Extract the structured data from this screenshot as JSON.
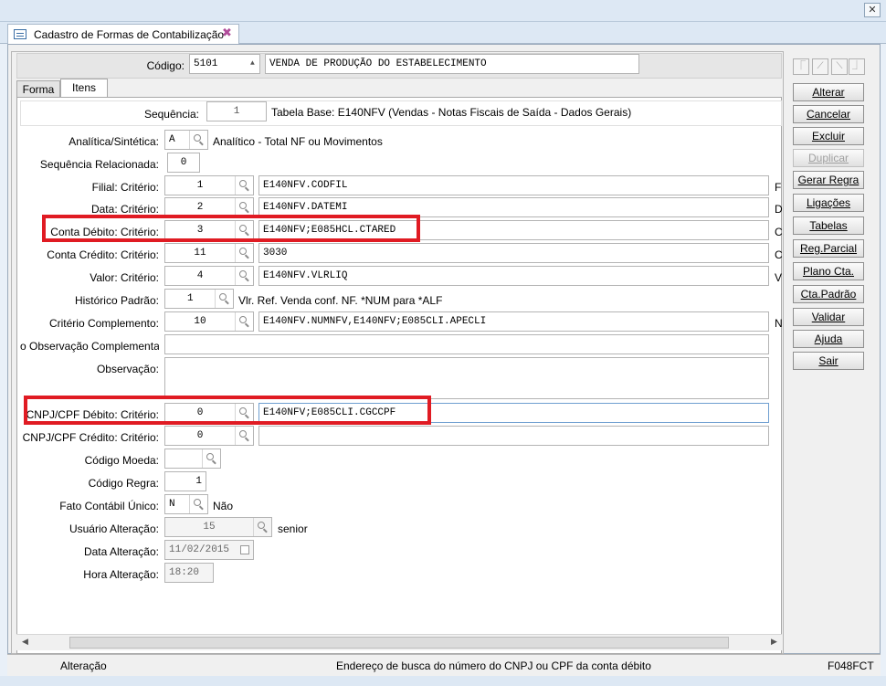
{
  "window": {
    "close_glyph": "✕"
  },
  "doc_tab": {
    "title": "Cadastro de Formas de Contabilização",
    "close_glyph": "✖"
  },
  "header": {
    "codigo_label": "Código:",
    "codigo_value": "5101",
    "descricao_value": "VENDA DE PRODUÇÃO DO ESTABELECIMENTO"
  },
  "subtabs": {
    "forma": "Forma",
    "itens": "Itens"
  },
  "sequencia": {
    "label": "Sequência:",
    "value": "1",
    "tabela_base": "Tabela Base: E140NFV (Vendas - Notas Fiscais de Saída - Dados Gerais)"
  },
  "form": {
    "analitica": {
      "label": "Analítica/Sintética:",
      "value": "A",
      "desc": "Analítico - Total NF ou Movimentos"
    },
    "seq_relacionada": {
      "label": "Sequência Relacionada:",
      "value": "0"
    },
    "filial": {
      "label": "Filial: Critério:",
      "num": "1",
      "expr": "E140NFV.CODFIL",
      "side": "F"
    },
    "data": {
      "label": "Data: Critério:",
      "num": "2",
      "expr": "E140NFV.DATEMI",
      "side": "D"
    },
    "conta_debito": {
      "label": "Conta Débito: Critério:",
      "num": "3",
      "expr": "E140NFV;E085HCL.CTARED",
      "side": "C"
    },
    "conta_credito": {
      "label": "Conta Crédito: Critério:",
      "num": "11",
      "expr": "3030",
      "side": "C"
    },
    "valor": {
      "label": "Valor: Critério:",
      "num": "4",
      "expr": "E140NFV.VLRLIQ",
      "side": "V"
    },
    "historico": {
      "label": "Histórico Padrão:",
      "num": "1",
      "desc": "Vlr. Ref. Venda conf. NF. *NUM para *ALF"
    },
    "complemento": {
      "label": "Critério Complemento:",
      "num": "10",
      "expr": "E140NFV.NUMNFV,E140NFV;E085CLI.APECLI",
      "side": "N"
    },
    "obs_complementar": {
      "label": "o Observação Complementar:",
      "value": ""
    },
    "observacao": {
      "label": "Observação:",
      "value": ""
    },
    "cnpj_debito": {
      "label": "CNPJ/CPF Débito: Critério:",
      "num": "0",
      "expr": "E140NFV;E085CLI.CGCCPF"
    },
    "cnpj_credito": {
      "label": "CNPJ/CPF Crédito: Critério:",
      "num": "0",
      "expr": ""
    },
    "codigo_moeda": {
      "label": "Código Moeda:",
      "value": ""
    },
    "codigo_regra": {
      "label": "Código Regra:",
      "value": "1"
    },
    "fato_contabil": {
      "label": "Fato Contábil Único:",
      "value": "N",
      "desc": "Não"
    },
    "usuario": {
      "label": "Usuário Alteração:",
      "value": "15",
      "desc": "senior"
    },
    "data_alteracao": {
      "label": "Data Alteração:",
      "value": "11/02/2015"
    },
    "hora_alteracao": {
      "label": "Hora Alteração:",
      "value": "18:20"
    }
  },
  "buttons": {
    "alterar": "Alterar",
    "cancelar": "Cancelar",
    "excluir": "Excluir",
    "duplicar": "Duplicar",
    "gerar_regra": "Gerar Regra",
    "ligacoes": "Ligações",
    "tabelas": "Tabelas",
    "reg_parcial": "Reg.Parcial",
    "plano_cta": "Plano Cta.",
    "cta_padrao": "Cta.Padrão",
    "validar": "Validar",
    "ajuda": "Ajuda",
    "sair": "Sair"
  },
  "nav_icons": [
    "first-record-icon",
    "previous-record-icon",
    "next-record-icon",
    "last-record-icon"
  ],
  "status": {
    "mode": "Alteração",
    "message": "Endereço de busca do número do CNPJ ou CPF da conta débito",
    "screen_code": "F048FCT"
  },
  "colors": {
    "highlight": "#e01b23",
    "chrome": "#dde8f4"
  }
}
